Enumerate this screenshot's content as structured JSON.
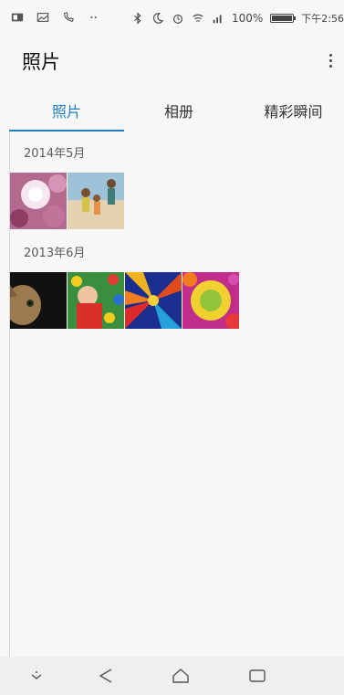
{
  "statusbar": {
    "time": "下午2:56",
    "battery": "100%"
  },
  "appbar": {
    "title": "照片"
  },
  "tabs": [
    {
      "label": "照片",
      "active": true
    },
    {
      "label": "相册",
      "active": false
    },
    {
      "label": "精彩瞬间",
      "active": false
    }
  ],
  "sections": [
    {
      "label": "2014年5月"
    },
    {
      "label": "2013年6月"
    }
  ],
  "colors": {
    "accent": "#1e7fc4",
    "background": "#f7f7f7"
  }
}
